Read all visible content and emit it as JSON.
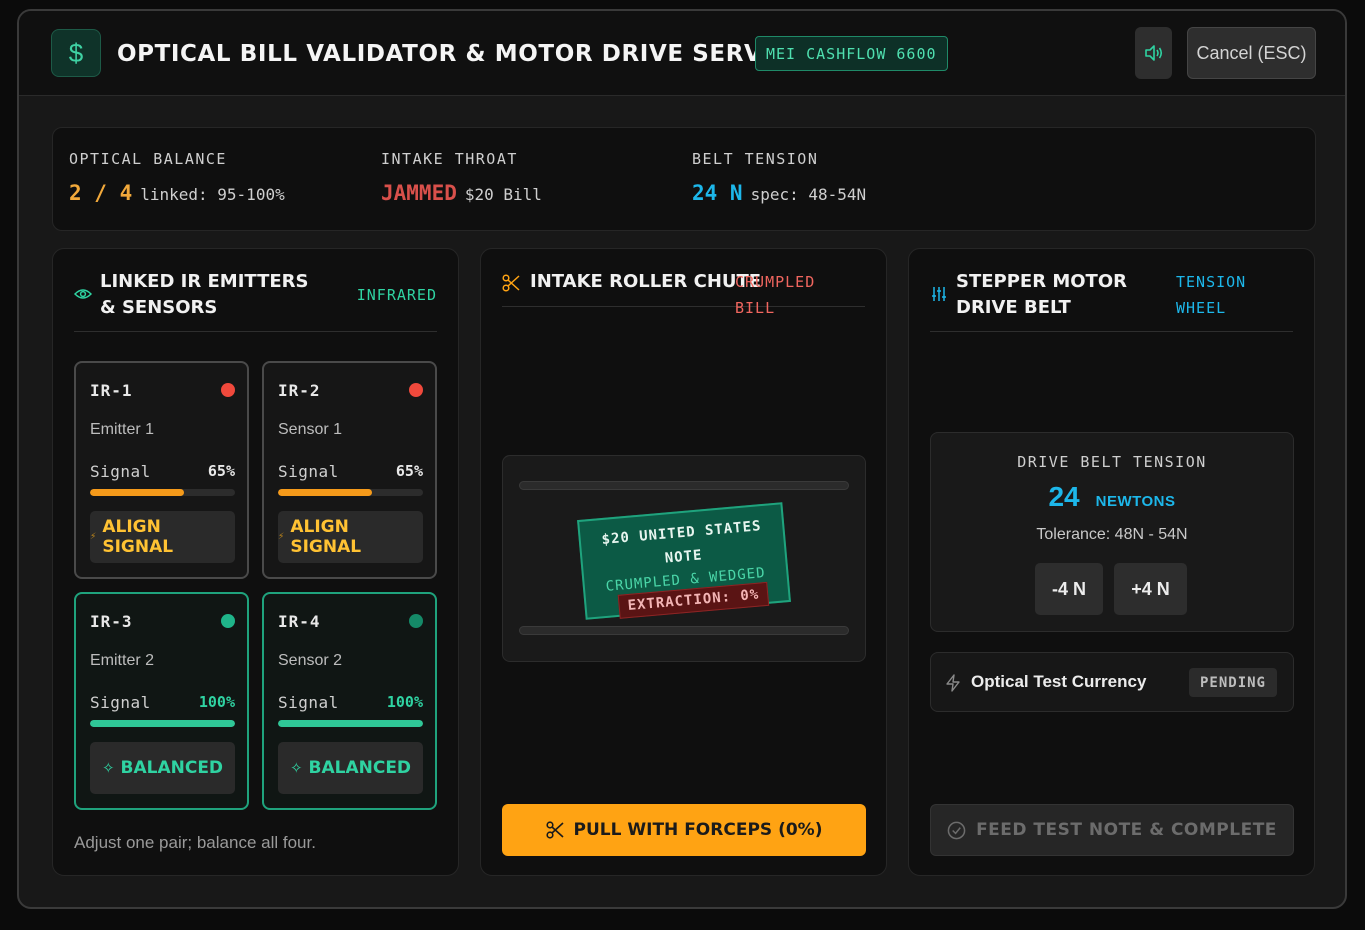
{
  "header": {
    "logo": "$",
    "title": "OPTICAL BILL VALIDATOR & MOTOR DRIVE SERVICE",
    "model_badge": "MEI CASHFLOW 6600",
    "sound_icon": "speaker-icon",
    "cancel_label": "Cancel (ESC)"
  },
  "stats": {
    "optical": {
      "label": "OPTICAL BALANCE",
      "value": "2 / 4",
      "sub": "linked: 95-100%",
      "color": "#f2a93b"
    },
    "intake": {
      "label": "INTAKE THROAT",
      "value": "JAMMED",
      "sub": "$20 Bill",
      "color": "#e0544f"
    },
    "belt": {
      "label": "BELT TENSION",
      "value": "24 N",
      "sub": "spec: 48-54N",
      "color": "#1db7ea"
    }
  },
  "ir_panel": {
    "title": "LINKED IR EMITTERS & SENSORS",
    "tag": "INFRARED",
    "icon": "eye-icon",
    "hint": "Adjust one pair; balance all four.",
    "cards": [
      {
        "id": "IR-1",
        "name": "Emitter 1",
        "signal_label": "Signal",
        "signal": "65%",
        "level": 0.65,
        "button": "ALIGN SIGNAL",
        "state": "warn"
      },
      {
        "id": "IR-2",
        "name": "Sensor 1",
        "signal_label": "Signal",
        "signal": "65%",
        "level": 0.65,
        "button": "ALIGN SIGNAL",
        "state": "warn"
      },
      {
        "id": "IR-3",
        "name": "Emitter 2",
        "signal_label": "Signal",
        "signal": "100%",
        "level": 1.0,
        "button": "BALANCED",
        "state": "ok"
      },
      {
        "id": "IR-4",
        "name": "Sensor 2",
        "signal_label": "Signal",
        "signal": "100%",
        "level": 1.0,
        "button": "BALANCED",
        "state": "ok"
      }
    ]
  },
  "chute_panel": {
    "title": "INTAKE ROLLER CHUTE",
    "tag": "CRUMPLED BILL",
    "icon": "scissors-icon",
    "bill_line1": "$20 UNITED STATES",
    "bill_line2": "NOTE",
    "bill_status": "CRUMPLED & WEDGED",
    "extraction": "EXTRACTION: 0%",
    "button": "PULL WITH FORCEPS (0%)"
  },
  "motor_panel": {
    "title": "STEPPER MOTOR DRIVE BELT",
    "tag": "TENSION WHEEL",
    "icon": "sliders-icon",
    "tension_label": "DRIVE BELT TENSION",
    "tension_value": "24",
    "tension_unit": "NEWTONS",
    "tolerance": "Tolerance: 48N - 54N",
    "dec_label": "-4 N",
    "inc_label": "+4 N",
    "test_label": "Optical Test Currency",
    "test_status": "PENDING",
    "feed_button": "FEED TEST NOTE & COMPLETE"
  },
  "colors": {
    "accent": "#1fa37d",
    "warn": "#f59a1a",
    "alarm_dot": "#f0493c",
    "ok_dot": "#1fb58a",
    "tension": "#1db7ea",
    "action": "#ffa313"
  }
}
